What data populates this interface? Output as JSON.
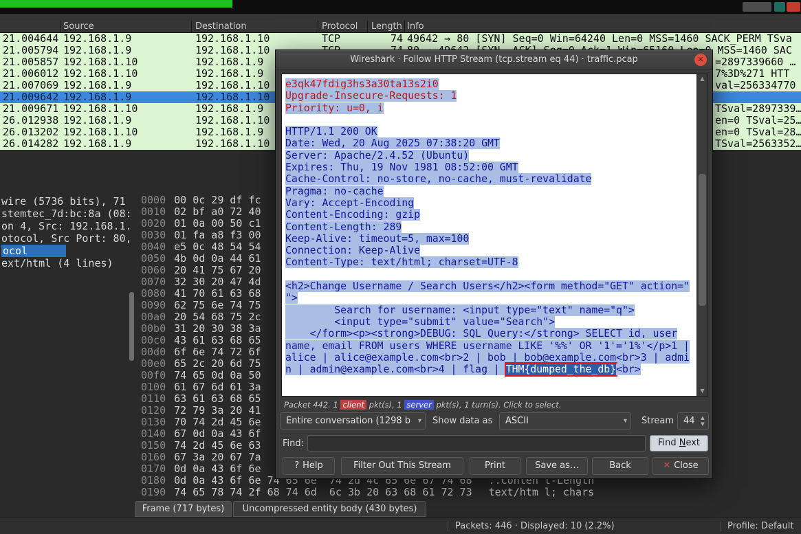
{
  "colors": {
    "row_green": "#dcf6d2",
    "row_selected": "#3e86de",
    "sel_bg": "#a8bee4",
    "client_fg": "#b41a1a",
    "server_fg": "#16169b",
    "flag_bg": "#2d5cab",
    "flag_border": "#e01818",
    "badge_client": "#c04040",
    "badge_server": "#4053cc"
  },
  "packet_list": {
    "columns": [
      "Source",
      "Destination",
      "Protocol",
      "Length",
      "Info"
    ],
    "rows": [
      {
        "time": "21.004644",
        "src": "192.168.1.9",
        "dst": "192.168.1.10",
        "proto": "TCP",
        "len": "74",
        "info": "49642 → 80 [SYN] Seq=0 Win=64240 Len=0 MSS=1460 SACK_PERM TSva",
        "frag": "",
        "selected": false
      },
      {
        "time": "21.005794",
        "src": "192.168.1.9",
        "dst": "192.168.1.10",
        "proto": "TCP",
        "len": "74",
        "info": "80 → 49642 [SYN, ACK] Seq=0 Ack=1 Win=65160 Len=0 MSS=1460 SAC",
        "frag": "",
        "selected": false
      },
      {
        "time": "21.005857",
        "src": "192.168.1.10",
        "dst": "192.168.1.9",
        "proto": "",
        "len": "",
        "info": "",
        "frag": "=2897339660 …",
        "selected": false
      },
      {
        "time": "21.006012",
        "src": "192.168.1.10",
        "dst": "192.168.1.9",
        "proto": "",
        "len": "",
        "info": "",
        "frag": "7%3D%271 HTT",
        "selected": false
      },
      {
        "time": "21.007069",
        "src": "192.168.1.9",
        "dst": "192.168.1.10",
        "proto": "",
        "len": "",
        "info": "",
        "frag": "val=256334770 …",
        "selected": false
      },
      {
        "time": "21.009642",
        "src": "192.168.1.9",
        "dst": "192.168.1.10",
        "proto": "",
        "len": "",
        "info": "",
        "frag": "",
        "selected": true
      },
      {
        "time": "21.009671",
        "src": "192.168.1.10",
        "dst": "192.168.1.9",
        "proto": "",
        "len": "",
        "info": "",
        "frag": "TSval=2897339…",
        "selected": false
      },
      {
        "time": "26.012938",
        "src": "192.168.1.9",
        "dst": "192.168.1.10",
        "proto": "",
        "len": "",
        "info": "",
        "frag": "en=0 TSval=25…",
        "selected": false
      },
      {
        "time": "26.013202",
        "src": "192.168.1.10",
        "dst": "192.168.1.9",
        "proto": "",
        "len": "",
        "info": "",
        "frag": "en=0 TSval=28…",
        "selected": false
      },
      {
        "time": "26.014282",
        "src": "192.168.1.9",
        "dst": "192.168.1.10",
        "proto": "",
        "len": "",
        "info": "",
        "frag": "TSval=2563352…",
        "selected": false
      }
    ]
  },
  "details_pane": {
    "lines": [
      "wire (5736 bits), 71",
      "stemtec_7d:bc:8a (08:",
      "on 4, Src: 192.168.1.",
      "otocol, Src Port: 80,",
      "ocol",
      "ext/html (4 lines)"
    ],
    "selected_index": 4
  },
  "hex_pane": {
    "rows": [
      {
        "off": "0000",
        "bytes": "00 0c 29 df fc"
      },
      {
        "off": "0010",
        "bytes": "02 bf a0 72 40"
      },
      {
        "off": "0020",
        "bytes": "01 0a 00 50 c1"
      },
      {
        "off": "0030",
        "bytes": "01 fa a8 f3 00"
      },
      {
        "off": "0040",
        "bytes": "e5 0c 48 54 54"
      },
      {
        "off": "0050",
        "bytes": "4b 0d 0a 44 61"
      },
      {
        "off": "0060",
        "bytes": "20 41 75 67 20"
      },
      {
        "off": "0070",
        "bytes": "32 30 20 47 4d"
      },
      {
        "off": "0080",
        "bytes": "41 70 61 63 68"
      },
      {
        "off": "0090",
        "bytes": "62 75 6e 74 75"
      },
      {
        "off": "00a0",
        "bytes": "20 54 68 75 2c"
      },
      {
        "off": "00b0",
        "bytes": "31 20 30 38 3a"
      },
      {
        "off": "00c0",
        "bytes": "43 61 63 68 65"
      },
      {
        "off": "00d0",
        "bytes": "6f 6e 74 72 6f"
      },
      {
        "off": "00e0",
        "bytes": "65 2c 20 6d 75"
      },
      {
        "off": "00f0",
        "bytes": "74 65 0d 0a 50"
      },
      {
        "off": "0100",
        "bytes": "61 67 6d 61 3a"
      },
      {
        "off": "0110",
        "bytes": "63 61 63 68 65"
      },
      {
        "off": "0120",
        "bytes": "72 79 3a 20 41"
      },
      {
        "off": "0130",
        "bytes": "70 74 2d 45 6e"
      },
      {
        "off": "0140",
        "bytes": "67 0d 0a 43 6f"
      },
      {
        "off": "0150",
        "bytes": "74 2d 45 6e 63"
      },
      {
        "off": "0160",
        "bytes": "67 3a 20 67 7a"
      },
      {
        "off": "0170",
        "bytes": "0d 0a 43 6f 6e"
      },
      {
        "off": "0180",
        "bytes": "0d 0a 43 6f 6e 74 65 6e  74 2d 4c 65 6e 67 74 68",
        "ascii": "..Conten t-Length"
      },
      {
        "off": "0190",
        "bytes": "74 65 78 74 2f 68 74 6d  6c 3b 20 63 68 61 72 73",
        "ascii": "text/htm l; chars"
      }
    ]
  },
  "tabs": [
    {
      "label": "Frame (717 bytes)"
    },
    {
      "label": "Uncompressed entity body (430 bytes)"
    }
  ],
  "status_bar": {
    "packets": "Packets: 446 · Displayed: 10 (2.2%)",
    "profile": "Profile: Default"
  },
  "dialog": {
    "title": "Wireshark · Follow HTTP Stream (tcp.stream eq 44) · traffic.pcap",
    "stream_lines": [
      {
        "side": "client",
        "text": "e3qk47fdig3hs3a30ta13s2i0"
      },
      {
        "side": "client",
        "text": "Upgrade-Insecure-Requests: 1"
      },
      {
        "side": "client",
        "text": "Priority: u=0, i"
      },
      {
        "blank": true
      },
      {
        "side": "server",
        "text": "HTTP/1.1 200 OK"
      },
      {
        "side": "server",
        "text": "Date: Wed, 20 Aug 2025 07:38:20 GMT"
      },
      {
        "side": "server",
        "text": "Server: Apache/2.4.52 (Ubuntu)"
      },
      {
        "side": "server",
        "text": "Expires: Thu, 19 Nov 1981 08:52:00 GMT"
      },
      {
        "side": "server",
        "text": "Cache-Control: no-store, no-cache, must-revalidate"
      },
      {
        "side": "server",
        "text": "Pragma: no-cache"
      },
      {
        "side": "server",
        "text": "Vary: Accept-Encoding"
      },
      {
        "side": "server",
        "text": "Content-Encoding: gzip"
      },
      {
        "side": "server",
        "text": "Content-Length: 289"
      },
      {
        "side": "server",
        "text": "Keep-Alive: timeout=5, max=100"
      },
      {
        "side": "server",
        "text": "Connection: Keep-Alive"
      },
      {
        "side": "server",
        "text": "Content-Type: text/html; charset=UTF-8"
      },
      {
        "blank": true
      },
      {
        "side": "server",
        "text": "<h2>Change Username / Search Users</h2><form method=\"GET\" action=\""
      },
      {
        "side": "server",
        "text": "\">"
      },
      {
        "side": "server",
        "text": "        Search for username: <input type=\"text\" name=\"q\">"
      },
      {
        "side": "server",
        "text": "        <input type=\"submit\" value=\"Search\">"
      },
      {
        "side": "server",
        "text": "    </form><p><strong>DEBUG: SQL Query:</strong> SELECT id, user"
      },
      {
        "side": "server",
        "text": "name, email FROM users WHERE username LIKE '%%' OR '1'='1%'</p>1 |"
      },
      {
        "side": "server",
        "text": "alice | alice@example.com<br>2 | bob | bob@example.com<br>3 | admi"
      },
      {
        "side": "server",
        "pre": "n | admin@example.com<br>4 | flag | ",
        "flag": "THM{dumped_the_db}",
        "post": "<br>"
      }
    ],
    "meta": {
      "prefix": "Packet 442. 1 ",
      "client": "client",
      "mid": " pkt(s), 1 ",
      "server": "server",
      "suffix": " pkt(s), 1 turn(s). Click to select."
    },
    "controls": {
      "conversation": "Entire conversation (1298 b",
      "show_data_as": "Show data as",
      "encoding": "ASCII",
      "stream_label": "Stream",
      "stream_value": "44"
    },
    "find": {
      "label": "Find:",
      "value": "",
      "button": {
        "pre": "Find ",
        "mnemonic": "N",
        "post": "ext"
      }
    },
    "buttons": [
      {
        "icon": "?",
        "icon_name": "help-icon",
        "icon_class": "",
        "label": "Help",
        "name": "help-button"
      },
      {
        "label": "Filter Out This Stream",
        "name": "filter-out-stream-button"
      },
      {
        "label": "Print",
        "name": "print-button"
      },
      {
        "label": "Save as…",
        "name": "save-as-button"
      },
      {
        "label": "Back",
        "name": "back-button"
      },
      {
        "icon": "✕",
        "icon_name": "close-icon",
        "icon_class": "close-x",
        "label": "Close",
        "name": "close-button"
      }
    ]
  }
}
